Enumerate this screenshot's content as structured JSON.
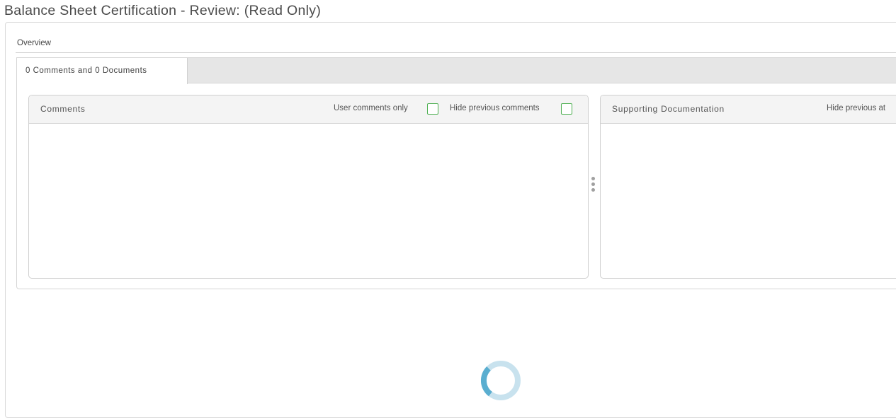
{
  "page": {
    "title": "Balance Sheet Certification - Review: (Read Only)"
  },
  "overview": {
    "label": "Overview"
  },
  "tabs": [
    {
      "label": "0 Comments and 0 Documents",
      "active": true
    }
  ],
  "comments_panel": {
    "title": "Comments",
    "user_comments_only_label": "User comments only",
    "hide_previous_comments_label": "Hide previous comments",
    "user_comments_only_checked": false,
    "hide_previous_comments_checked": false
  },
  "docs_panel": {
    "title": "Supporting Documentation",
    "hide_previous_label": "Hide previous at"
  },
  "colors": {
    "checkbox_border": "#4caf50",
    "spinner_light": "#c8e2ee",
    "spinner_dark": "#5aaed0"
  },
  "icons": {
    "splitter": "vertical-dots-icon",
    "loading": "loading-spinner-icon"
  }
}
